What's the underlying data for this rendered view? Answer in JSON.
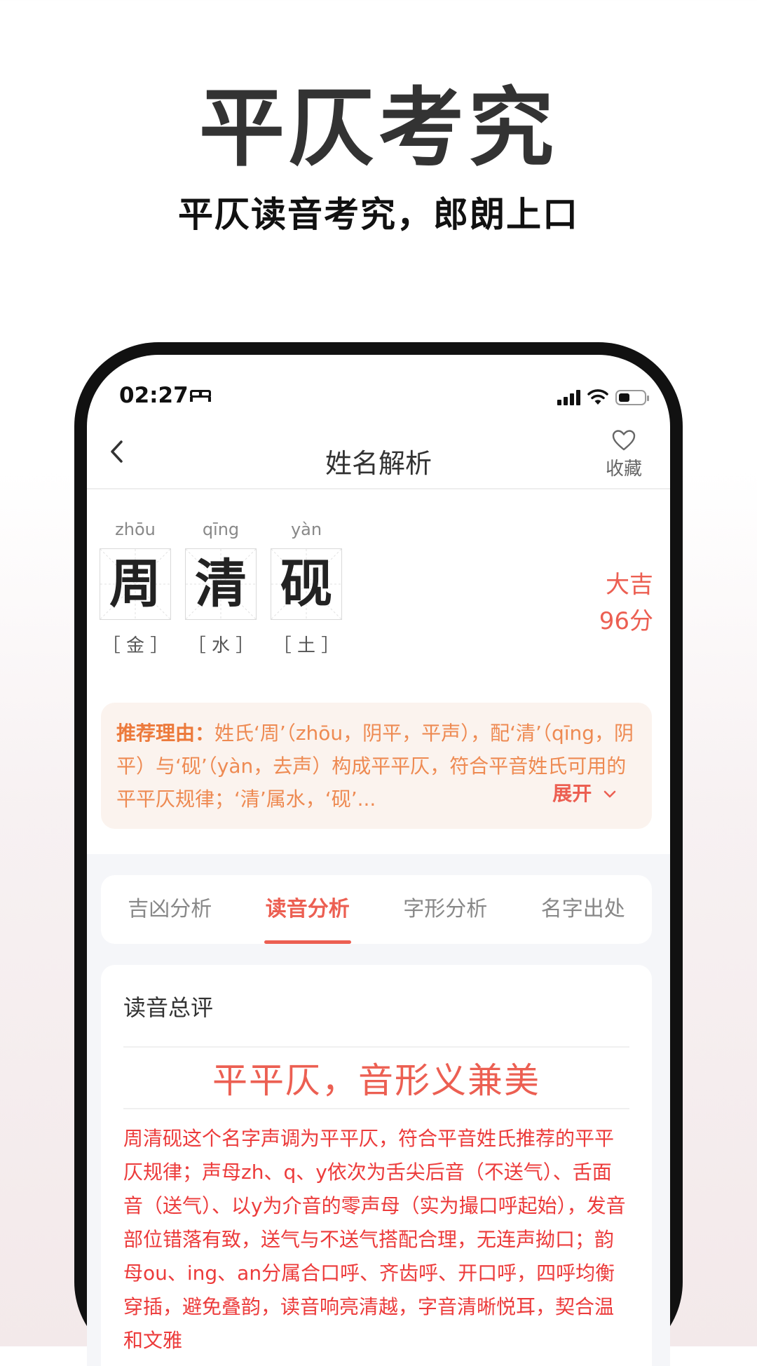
{
  "promo": {
    "title": "平仄考究",
    "subtitle": "平仄读音考究，郎朗上口"
  },
  "status_bar": {
    "time": "02:27",
    "icons": [
      "bed-icon",
      "signal-icon",
      "wifi-icon",
      "battery-icon"
    ],
    "battery_level": 0.45
  },
  "nav": {
    "title": "姓名解析",
    "back_icon": "chevron-left-icon",
    "favorite_icon": "heart-icon",
    "favorite_label": "收藏"
  },
  "name": {
    "characters": [
      {
        "pinyin": "zhōu",
        "char": "周",
        "element": "［ 金 ］"
      },
      {
        "pinyin": "qīng",
        "char": "清",
        "element": "［ 水 ］"
      },
      {
        "pinyin": "yàn",
        "char": "砚",
        "element": "［ 土 ］"
      }
    ],
    "rating": "大吉",
    "score": "96分"
  },
  "reason": {
    "label": "推荐理由：",
    "text": "姓氏‘周’（zhōu，阴平，平声），配‘清’（qīng，阴平）与‘砚’（yàn，去声）构成平平仄，符合平音姓氏可用的平平仄规律；‘清’属水，‘砚’...",
    "expand_label": "展开",
    "expand_icon": "chevron-down-icon"
  },
  "tabs": [
    {
      "label": "吉凶分析",
      "active": false
    },
    {
      "label": "读音分析",
      "active": true
    },
    {
      "label": "字形分析",
      "active": false
    },
    {
      "label": "名字出处",
      "active": false
    }
  ],
  "pronunciation": {
    "section_title": "读音总评",
    "headline": "平平仄，音形义兼美",
    "body": "周清砚这个名字声调为平平仄，符合平音姓氏推荐的平平仄规律；声母zh、q、y依次为舌尖后音（不送气）、舌面音（送气）、以y为介音的零声母（实为撮口呼起始），发音部位错落有致，送气与不送气搭配合理，无连声拗口；韵母ou、ing、an分属合口呼、齐齿呼、开口呼，四呼均衡穿插，避免叠韵，读音响亮清越，字音清晰悦耳，契合温和文雅"
  },
  "colors": {
    "accent": "#ec5f52",
    "reason_text": "#ee8a52",
    "reason_bg": "#fbf3ee",
    "body_text": "#ec3b3b"
  }
}
